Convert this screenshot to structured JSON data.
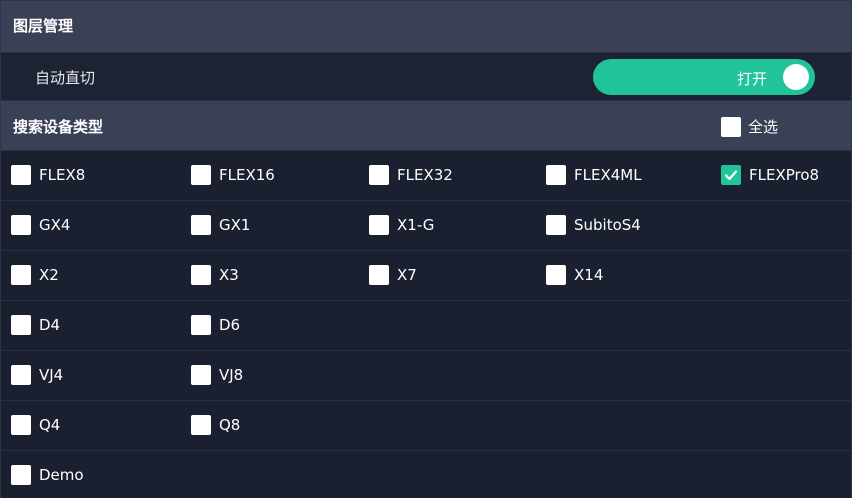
{
  "header": {
    "title": "图层管理"
  },
  "auto_cut": {
    "label": "自动直切",
    "toggle_label": "打开",
    "state": "on"
  },
  "search": {
    "title": "搜索设备类型",
    "select_all_label": "全选",
    "select_all_checked": false
  },
  "devices": [
    [
      {
        "label": "FLEX8",
        "checked": false
      },
      {
        "label": "FLEX16",
        "checked": false
      },
      {
        "label": "FLEX32",
        "checked": false
      },
      {
        "label": "FLEX4ML",
        "checked": false
      },
      {
        "label": "FLEXPro8",
        "checked": true
      }
    ],
    [
      {
        "label": "GX4",
        "checked": false
      },
      {
        "label": "GX1",
        "checked": false
      },
      {
        "label": "X1-G",
        "checked": false
      },
      {
        "label": "SubitoS4",
        "checked": false
      }
    ],
    [
      {
        "label": "X2",
        "checked": false
      },
      {
        "label": "X3",
        "checked": false
      },
      {
        "label": "X7",
        "checked": false
      },
      {
        "label": "X14",
        "checked": false
      }
    ],
    [
      {
        "label": "D4",
        "checked": false
      },
      {
        "label": "D6",
        "checked": false
      }
    ],
    [
      {
        "label": "VJ4",
        "checked": false
      },
      {
        "label": "VJ8",
        "checked": false
      }
    ],
    [
      {
        "label": "Q4",
        "checked": false
      },
      {
        "label": "Q8",
        "checked": false
      }
    ],
    [
      {
        "label": "Demo",
        "checked": false
      }
    ]
  ],
  "colors": {
    "accent": "#20c39a",
    "header_bg": "#3a4156",
    "panel_bg": "#1b2030"
  },
  "icons": {
    "checkmark": "check-icon",
    "toggle_knob": "toggle-knob-icon"
  }
}
